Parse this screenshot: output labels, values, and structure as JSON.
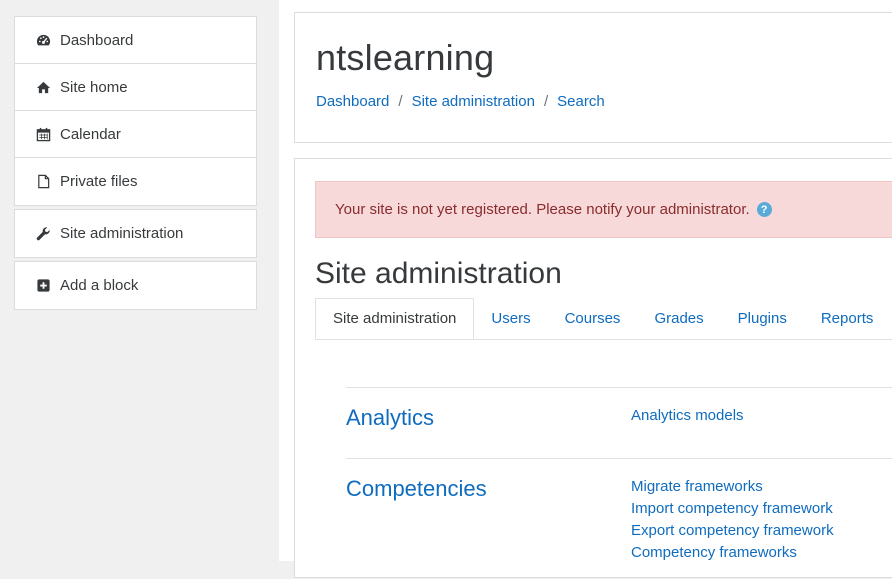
{
  "sidebar": {
    "nav_items": [
      {
        "label": "Dashboard",
        "icon": "dashboard-icon"
      },
      {
        "label": "Site home",
        "icon": "home-icon"
      },
      {
        "label": "Calendar",
        "icon": "calendar-icon"
      },
      {
        "label": "Private files",
        "icon": "file-icon"
      }
    ],
    "admin_item": {
      "label": "Site administration",
      "icon": "wrench-icon"
    },
    "add_block": {
      "label": "Add a block",
      "icon": "plus-square-icon"
    }
  },
  "header": {
    "site_name": "ntslearning",
    "breadcrumb": [
      "Dashboard",
      "Site administration",
      "Search"
    ],
    "separator": "/"
  },
  "alert": {
    "message": "Your site is not yet registered. Please notify your administrator.",
    "help_glyph": "?"
  },
  "main": {
    "heading": "Site administration",
    "tabs": [
      "Site administration",
      "Users",
      "Courses",
      "Grades",
      "Plugins",
      "Reports"
    ],
    "sections": [
      {
        "title": "Analytics",
        "links": [
          "Analytics models"
        ]
      },
      {
        "title": "Competencies",
        "links": [
          "Migrate frameworks",
          "Import competency framework",
          "Export competency framework",
          "Competency frameworks"
        ]
      }
    ]
  },
  "colors": {
    "link": "#0f6cbf",
    "alert_bg": "#f7d9da",
    "alert_text": "#8a2c2e",
    "help_icon": "#5aaad9"
  }
}
